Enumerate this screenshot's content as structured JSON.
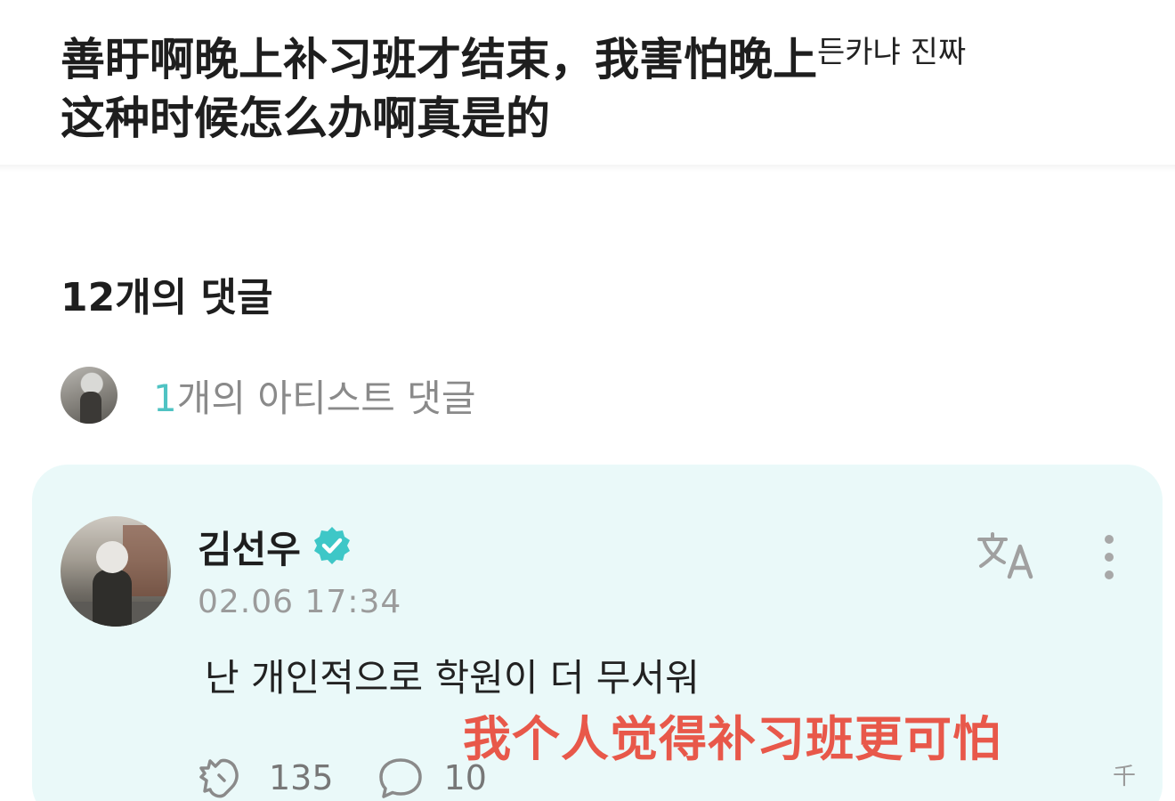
{
  "post": {
    "title_line1": "善盱啊晚上补习班才结束，我害怕晚上",
    "title_overflow": "든카냐 진짜",
    "title_line2": "这种时候怎么办啊真是的"
  },
  "comments": {
    "count_label": "12개의 댓글",
    "artist_num": "1",
    "artist_label": "개의 아티스트 댓글"
  },
  "comment": {
    "author": "김선우",
    "timestamp": "02.06 17:34",
    "text": "난 개인적으로 학원이 더 무서워",
    "overlay_caption": "我个人觉得补习班更可怕",
    "likes": "135",
    "replies": "10"
  },
  "watermark": "千",
  "colors": {
    "accent": "#4fc3c3",
    "card_bg": "#eaf9f9",
    "caption": "#e8584a"
  }
}
